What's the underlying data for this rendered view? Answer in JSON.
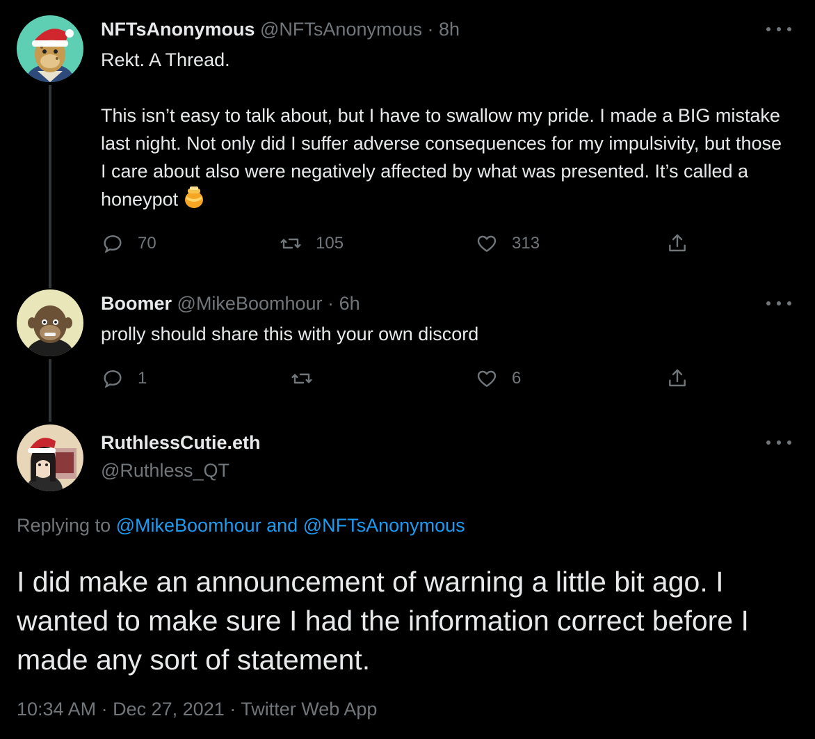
{
  "tweets": [
    {
      "display_name": "NFTsAnonymous",
      "handle": "@NFTsAnonymous",
      "separator": "·",
      "time": "8h",
      "paragraphs": [
        "Rekt. A Thread.",
        "This isn’t easy to talk about, but I have to swallow my pride. I made a BIG mistake last night. Not only did I suffer adverse consequences for my impulsivity, but those I care about also were negatively affected by what was presented. It’s called a honeypot"
      ],
      "emoji": "honey-pot-emoji",
      "replies": "70",
      "retweets": "105",
      "likes": "313",
      "avatar_icon": "bored-ape-santa-hat-avatar"
    },
    {
      "display_name": "Boomer",
      "handle": "@MikeBoomhour",
      "separator": "·",
      "time": "6h",
      "paragraphs": [
        "prolly should share this with your own discord"
      ],
      "replies": "1",
      "retweets": "",
      "likes": "6",
      "avatar_icon": "bored-ape-hoodie-avatar"
    }
  ],
  "focused_tweet": {
    "display_name": "RuthlessCutie.eth",
    "handle": "@Ruthless_QT",
    "replying_prefix": "Replying to",
    "replying_user_1": "@MikeBoomhour",
    "replying_and": "and",
    "replying_user_2": "@NFTsAnonymous",
    "text": "I did make an announcement of warning a little bit ago. I wanted to make sure I had the information correct before I made any sort of statement.",
    "time": "10:34 AM",
    "separator": "·",
    "date": "Dec 27, 2021",
    "source": "Twitter Web App",
    "avatar_icon": "anime-girl-santa-hat-avatar"
  },
  "colors": {
    "background": "#000000",
    "primary_text": "#e7e9ea",
    "secondary_text": "#71767b",
    "link": "#1d9bf0",
    "thread_line": "#333639"
  }
}
